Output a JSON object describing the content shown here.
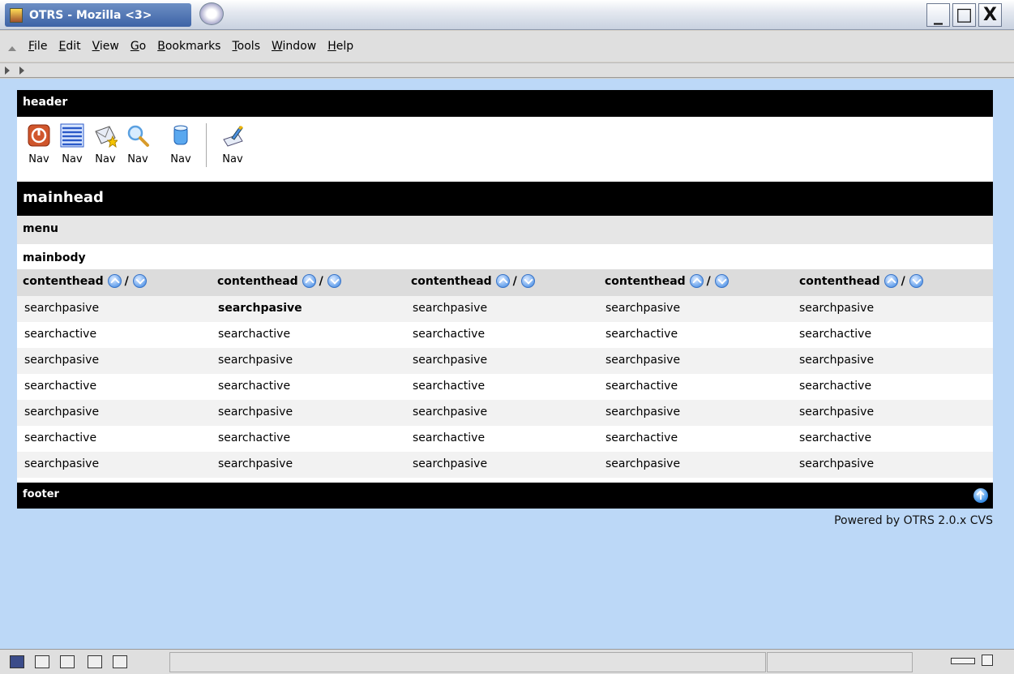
{
  "window": {
    "title": "OTRS - Mozilla <3>",
    "controls": {
      "minimize": "_",
      "maximize": "□",
      "close": "X"
    }
  },
  "menubar": {
    "items": [
      "File",
      "Edit",
      "View",
      "Go",
      "Bookmarks",
      "Tools",
      "Window",
      "Help"
    ]
  },
  "header": {
    "title": "header",
    "nav": [
      {
        "label": "Nav",
        "icon": "power-icon"
      },
      {
        "label": "Nav",
        "icon": "list-icon"
      },
      {
        "label": "Nav",
        "icon": "mail-star-icon"
      },
      {
        "label": "Nav",
        "icon": "search-icon"
      },
      {
        "label": "Nav",
        "icon": "database-icon"
      },
      {
        "label": "Nav",
        "icon": "document-pen-icon"
      }
    ]
  },
  "mainhead": "mainhead",
  "menu": "menu",
  "mainbody": {
    "title": "mainbody",
    "columns": [
      "contenthead",
      "contenthead",
      "contenthead",
      "contenthead",
      "contenthead"
    ],
    "sort_separator": "/",
    "rows": [
      [
        "searchpasive",
        "searchpasive",
        "searchpasive",
        "searchpasive",
        "searchpasive"
      ],
      [
        "searchactive",
        "searchactive",
        "searchactive",
        "searchactive",
        "searchactive"
      ],
      [
        "searchpasive",
        "searchpasive",
        "searchpasive",
        "searchpasive",
        "searchpasive"
      ],
      [
        "searchactive",
        "searchactive",
        "searchactive",
        "searchactive",
        "searchactive"
      ],
      [
        "searchpasive",
        "searchpasive",
        "searchpasive",
        "searchpasive",
        "searchpasive"
      ],
      [
        "searchactive",
        "searchactive",
        "searchactive",
        "searchactive",
        "searchactive"
      ],
      [
        "searchpasive",
        "searchpasive",
        "searchpasive",
        "searchpasive",
        "searchpasive"
      ]
    ]
  },
  "footer": {
    "label": "footer"
  },
  "powered_by": "Powered by OTRS 2.0.x CVS",
  "colors": {
    "page_bg": "#bcd8f7",
    "bar_bg": "#000000",
    "pasive_row": "#f2f2f2"
  }
}
